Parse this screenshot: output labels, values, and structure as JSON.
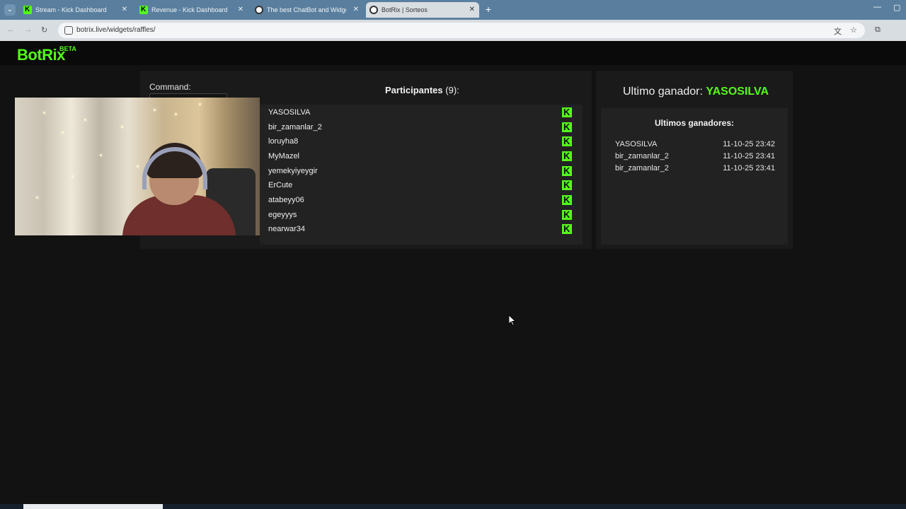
{
  "browser": {
    "tabs": [
      {
        "title": "Stream - Kick Dashboard",
        "icon": "kick-icon",
        "active": false
      },
      {
        "title": "Revenue - Kick Dashboard",
        "icon": "kick-icon",
        "active": false
      },
      {
        "title": "The best ChatBot and Widgets",
        "icon": "botrix-icon",
        "active": false
      },
      {
        "title": "BotRix | Sorteos",
        "icon": "botrix-icon",
        "active": true
      }
    ],
    "url": "botrix.live/widgets/raffles/"
  },
  "app": {
    "logo": "BotRix",
    "badge": "BETA"
  },
  "raffle": {
    "command_label": "Command:",
    "participants_title": "Participantes",
    "participants_count": "(9):",
    "participants": [
      "YASOSILVA",
      "bir_zamanlar_2",
      "loruyha8",
      "MyMazel",
      "yemekyiyeygir",
      "ErCute",
      "atabeyy06",
      "egeyyys",
      "nearwar34"
    ],
    "platform_icon": "kick-icon"
  },
  "winners": {
    "last_label": "Ultimo ganador:",
    "last_name": "YASOSILVA",
    "list_title": "Ultimos ganadores:",
    "list": [
      {
        "name": "YASOSILVA",
        "time": "11-10-25 23:42"
      },
      {
        "name": "bir_zamanlar_2",
        "time": "11-10-25 23:41"
      },
      {
        "name": "bir_zamanlar_2",
        "time": "11-10-25 23:41"
      }
    ]
  },
  "colors": {
    "accent": "#53fc18",
    "background": "#121212",
    "panel": "#1a1a1a",
    "list_bg": "#222222"
  }
}
